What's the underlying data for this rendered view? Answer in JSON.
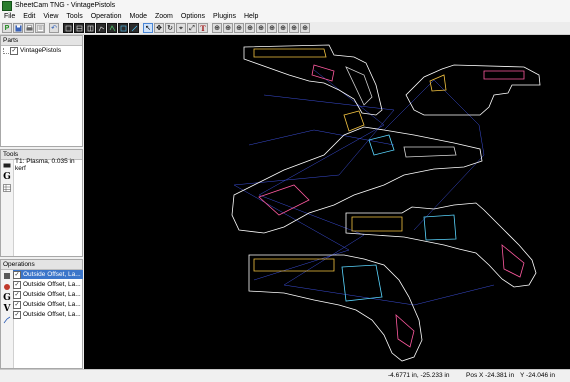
{
  "window": {
    "title": "SheetCam TNG - VintagePistols"
  },
  "menu": [
    "File",
    "Edit",
    "View",
    "Tools",
    "Operation",
    "Mode",
    "Zoom",
    "Options",
    "Plugins",
    "Help"
  ],
  "panels": {
    "parts": {
      "title": "Parts",
      "items": [
        {
          "label": "VintagePistols",
          "checked": true
        }
      ]
    },
    "tools": {
      "title": "Tools",
      "items": [
        {
          "label": "T1: Plasma, 0.035 in kerf"
        }
      ]
    },
    "operations": {
      "title": "Operations",
      "items": [
        {
          "label": "Outside Offset, La...",
          "checked": true
        },
        {
          "label": "Outside Offset, La...",
          "checked": true
        },
        {
          "label": "Outside Offset, La...",
          "checked": true
        },
        {
          "label": "Outside Offset, La...",
          "checked": true
        },
        {
          "label": "Outside Offset, La...",
          "checked": true
        }
      ]
    }
  },
  "status": {
    "cursor": "-4.6771 in, -25.233 in",
    "pos_x": "Pos X  -24.381 in",
    "pos_y": "Y  -24.046 in"
  },
  "colors": {
    "viewport_bg": "#000000",
    "selected": "#3b75c9"
  }
}
